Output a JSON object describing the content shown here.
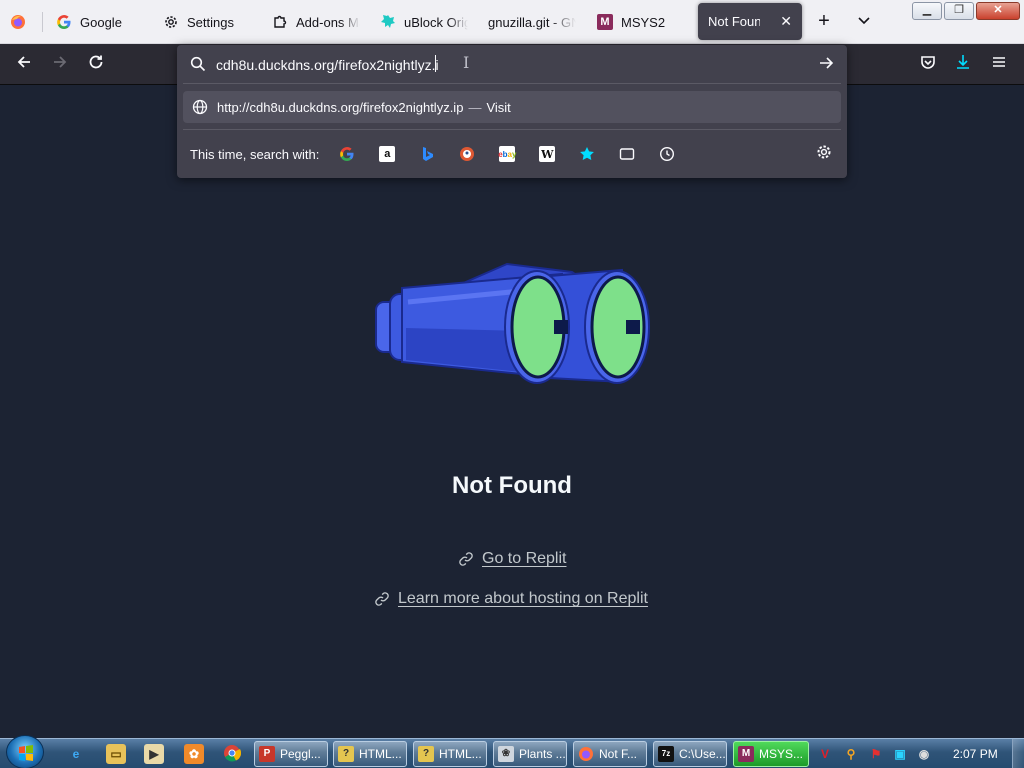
{
  "tabs": [
    {
      "label": "Google",
      "icon": "google-icon"
    },
    {
      "label": "Settings",
      "icon": "gear-icon"
    },
    {
      "label": "Add-ons Ma",
      "icon": "puzzle-icon"
    },
    {
      "label": "uBlock Origi",
      "icon": "ublock-icon"
    },
    {
      "label": "gnuzilla.git - GN",
      "icon": "none"
    },
    {
      "label": "MSYS2",
      "icon": "msys2-icon"
    },
    {
      "label": "Not Found",
      "icon": "none",
      "active": true
    }
  ],
  "urlbar": {
    "value": "cdh8u.duckdns.org/firefox2nightlyz.i",
    "suggestion_url": "http://cdh8u.duckdns.org/firefox2nightlyz.ip",
    "suggestion_sep": "—",
    "suggestion_action": "Visit",
    "search_with_label": "This time, search with:",
    "engines": [
      "Google",
      "Amazon",
      "Bing",
      "DuckDuckGo",
      "eBay",
      "Wikipedia",
      "Bookmarks",
      "Tabs",
      "History"
    ]
  },
  "page": {
    "heading": "Not Found",
    "link1": "Go to Replit",
    "link2": "Learn more about hosting on Replit"
  },
  "taskbar": {
    "buttons": [
      "Peggl...",
      "HTML...",
      "HTML...",
      "Plants ...",
      "Not F...",
      "C:\\Use...",
      "MSYS..."
    ],
    "clock": "2:07 PM"
  },
  "colors": {
    "page_bg": "#1c2333",
    "panel_bg": "#42414d",
    "binocular_blue": "#3d5ae0",
    "lens_green": "#7ee08a",
    "taskbar_active": "#2fb93a"
  }
}
